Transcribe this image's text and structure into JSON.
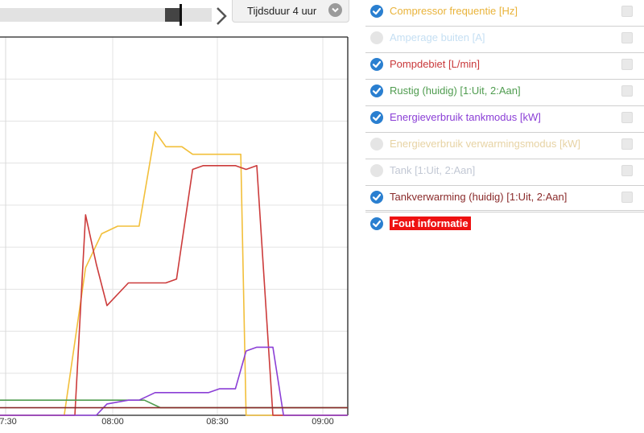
{
  "toolbar": {
    "duration_label": "Tijdsduur 4 uur",
    "slider_position": 0.85
  },
  "chart_data": {
    "type": "line",
    "x_ticks": [
      "07:30",
      "08:00",
      "08:30",
      "09:00"
    ],
    "x_range_minutes": [
      -7,
      58
    ],
    "y_range": [
      0,
      1
    ],
    "grid": true,
    "series": [
      {
        "name": "Compressor frequentie [Hz]",
        "color": "#f2bf3a",
        "x": [
          -7,
          5,
          9,
          12,
          15,
          19,
          22,
          24,
          27,
          29,
          31,
          34,
          36,
          38,
          39,
          40,
          42,
          44,
          47,
          50,
          55,
          58
        ],
        "y": [
          0,
          0,
          0.39,
          0.48,
          0.5,
          0.5,
          0.75,
          0.71,
          0.71,
          0.69,
          0.69,
          0.69,
          0.69,
          0.69,
          0,
          0,
          0,
          0,
          0,
          0,
          0,
          0
        ]
      },
      {
        "name": "Pompdebiet [L/min]",
        "color": "#cc3b3b",
        "x": [
          -7,
          4,
          7,
          9,
          11,
          13,
          17,
          20,
          22,
          24,
          26,
          29,
          31,
          34,
          36,
          37,
          39,
          41,
          44,
          46,
          48,
          51,
          58
        ],
        "y": [
          0,
          0,
          0,
          0.53,
          0.4,
          0.29,
          0.35,
          0.35,
          0.35,
          0.35,
          0.36,
          0.65,
          0.66,
          0.66,
          0.66,
          0.66,
          0.65,
          0.66,
          0,
          0,
          0,
          0,
          0
        ]
      },
      {
        "name": "Rustig (huidig) [1:Uit, 2:Aan]",
        "color": "#4f9c4f",
        "x": [
          -7,
          5,
          9,
          12,
          17,
          20,
          23,
          25,
          30,
          35,
          40,
          45,
          50,
          58
        ],
        "y": [
          0.04,
          0.04,
          0.04,
          0.04,
          0.04,
          0.04,
          0.02,
          0.02,
          0.02,
          0.02,
          0.02,
          0.02,
          0.02,
          0.02
        ]
      },
      {
        "name": "Energieverbruik tankmodus [kW]",
        "color": "#8b3fd6",
        "x": [
          -7,
          5,
          7,
          9,
          11,
          13,
          17,
          19,
          22,
          24,
          27,
          30,
          32,
          34,
          37,
          39,
          41,
          42,
          44,
          46,
          49,
          52,
          58
        ],
        "y": [
          0,
          0,
          0,
          0,
          0,
          0.03,
          0.04,
          0.04,
          0.06,
          0.06,
          0.06,
          0.06,
          0.06,
          0.07,
          0.07,
          0.17,
          0.18,
          0.18,
          0.18,
          0,
          0,
          0,
          0
        ]
      },
      {
        "name": "Tankverwarming (huidig) [1:Uit, 2:Aan]",
        "color": "#8a2b2b",
        "x": [
          -7,
          10,
          20,
          30,
          40,
          50,
          58
        ],
        "y": [
          0.02,
          0.02,
          0.02,
          0.02,
          0.02,
          0.02,
          0.02
        ]
      }
    ]
  },
  "legend": {
    "items": [
      {
        "label": "Compressor frequentie [Hz]",
        "checked": true,
        "color": "#e9b33a"
      },
      {
        "label": "Amperage buiten [A]",
        "checked": false,
        "color": "#c5dff3"
      },
      {
        "label": "Pompdebiet [L/min]",
        "checked": true,
        "color": "#c9383a"
      },
      {
        "label": "Rustig (huidig) [1:Uit, 2:Aan]",
        "checked": true,
        "color": "#4f9c4f"
      },
      {
        "label": "Energieverbruik tankmodus [kW]",
        "checked": true,
        "color": "#8b3fd6"
      },
      {
        "label": "Energieverbruik verwarmingsmodus [kW]",
        "checked": false,
        "color": "#e7d3a4"
      },
      {
        "label": "Tank [1:Uit, 2:Aan]",
        "checked": false,
        "color": "#c2c8d4"
      },
      {
        "label": "Tankverwarming (huidig) [1:Uit, 2:Aan]",
        "checked": true,
        "color": "#8a2b2b"
      },
      {
        "label": "Fout informatie",
        "checked": true,
        "color": "#ffffff",
        "error": true
      }
    ]
  }
}
